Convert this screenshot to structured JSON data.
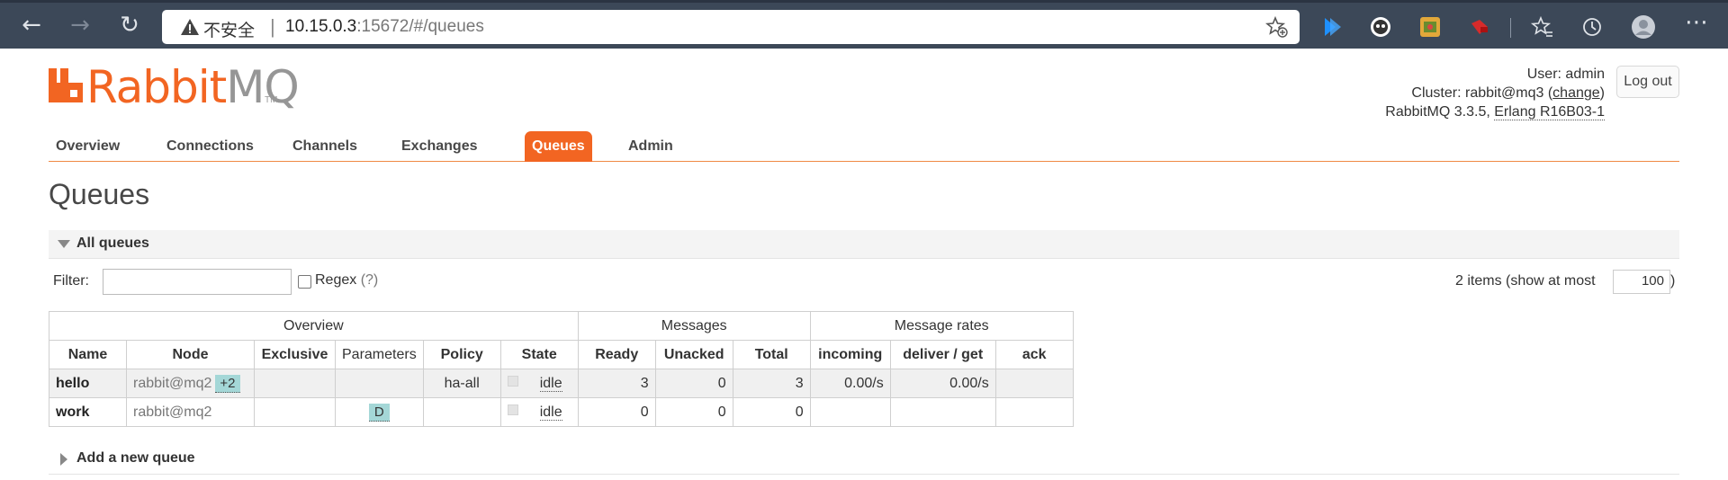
{
  "browser": {
    "insecure_label": "不安全",
    "separator": "|",
    "url_host": "10.15.0.3",
    "url_path": ":15672/#/queues"
  },
  "header": {
    "logo_rabbit": "Rabbit",
    "logo_mq": "MQ",
    "logo_tm": "TM",
    "user_label": "User:",
    "user_value": "admin",
    "cluster_label": "Cluster:",
    "cluster_value": "rabbit@mq3",
    "change_link": "change",
    "version_text": "RabbitMQ 3.3.5,",
    "erlang_text": "Erlang R16B03-1",
    "logout_label": "Log out"
  },
  "tabs": [
    {
      "label": "Overview"
    },
    {
      "label": "Connections"
    },
    {
      "label": "Channels"
    },
    {
      "label": "Exchanges"
    },
    {
      "label": "Queues",
      "active": true
    },
    {
      "label": "Admin"
    }
  ],
  "page_title": "Queues",
  "all_queues": {
    "section_label": "All queues",
    "filter_label": "Filter:",
    "filter_value": "",
    "regex_label": "Regex",
    "regex_help": "(?)",
    "items_text": "2 items (show at most",
    "items_limit": "100",
    "items_close": ")"
  },
  "table": {
    "group_headers": [
      "Overview",
      "Messages",
      "Message rates"
    ],
    "columns": [
      "Name",
      "Node",
      "Exclusive",
      "Parameters",
      "Policy",
      "State",
      "Ready",
      "Unacked",
      "Total",
      "incoming",
      "deliver / get",
      "ack"
    ],
    "rows": [
      {
        "name": "hello",
        "node": "rabbit@mq2",
        "node_tag": "+2",
        "exclusive": "",
        "parameters": "",
        "policy": "ha-all",
        "state": "idle",
        "ready": "3",
        "unacked": "0",
        "total": "3",
        "incoming": "0.00/s",
        "deliver_get": "0.00/s",
        "ack": ""
      },
      {
        "name": "work",
        "node": "rabbit@mq2",
        "node_tag": "",
        "exclusive": "",
        "parameters": "D",
        "policy": "",
        "state": "idle",
        "ready": "0",
        "unacked": "0",
        "total": "0",
        "incoming": "",
        "deliver_get": "",
        "ack": ""
      }
    ]
  },
  "add_queue_label": "Add a new queue",
  "colors": {
    "brand": "#f26522",
    "chrome": "#3c4858",
    "tag_bg": "#a4d7d7"
  }
}
